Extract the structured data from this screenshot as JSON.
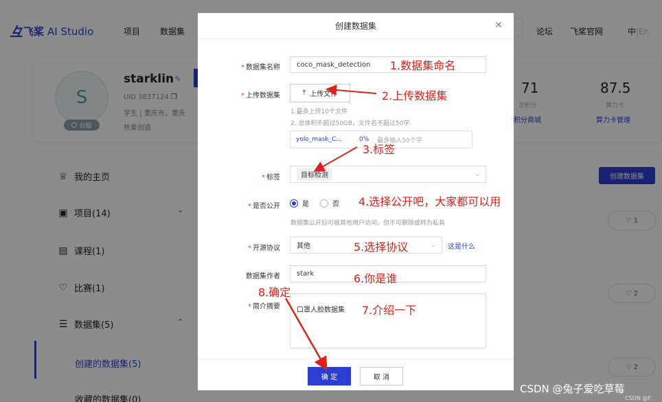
{
  "nav": {
    "logo_text": "飞桨",
    "logo_suffix": "AI Studio",
    "items": [
      "项目",
      "数据集"
    ],
    "right_items": [
      "论坛",
      "飞桨官网"
    ],
    "lang_active": "中",
    "lang_sep": "|",
    "lang_inactive": "En"
  },
  "profile": {
    "avatar_letter": "S",
    "badge": "白银",
    "name": "starklin",
    "uid": "UID 3837124",
    "school": "学生 | 重庆市，重庆",
    "hobby": "热爱创造",
    "stats": [
      {
        "value": "71",
        "label": "总积分",
        "link": "积分商城"
      },
      {
        "value": "87.5",
        "label": "算力卡",
        "link": "算力卡管理"
      }
    ]
  },
  "sidebar": {
    "items": [
      {
        "label": "我的主页",
        "icon": "trophy-icon"
      },
      {
        "label": "项目(14)",
        "icon": "project-icon"
      },
      {
        "label": "课程(1)",
        "icon": "course-icon"
      },
      {
        "label": "比赛(1)",
        "icon": "cup-icon"
      },
      {
        "label": "数据集(5)",
        "icon": "database-icon"
      }
    ],
    "sub_items": [
      "创建的数据集(5)",
      "收藏的数据集(0)"
    ]
  },
  "content": {
    "create_button": "创建数据集",
    "likes": [
      "1",
      "2",
      "2"
    ]
  },
  "modal": {
    "title": "创建数据集",
    "name_label": "数据集名称",
    "name_value": "coco_mask_detection",
    "upload_label": "上传数据集",
    "upload_button": "上传文件",
    "upload_hint1": "1.最多上传10个文件",
    "upload_hint2": "2. 总体积不超过50GB，文件名不超过50字",
    "file_name": "yolo_mask_C...",
    "file_progress": "0%",
    "file_placeholder": "最多输入50个字",
    "tag_label": "标签",
    "tag_value": "目标检测",
    "public_label": "是否公开",
    "public_yes": "是",
    "public_no": "否",
    "public_hint": "数据集公开后可被其他用户访问，但不可删除或转为私有",
    "license_label": "开源协议",
    "license_value": "其他",
    "license_link": "这是什么",
    "author_label": "数据集作者",
    "author_value": "stark",
    "desc_label": "简介摘要",
    "desc_value": "口罩人脸数据集",
    "ok": "确 定",
    "cancel": "取 消"
  },
  "annotations": {
    "a1": "1.数据集命名",
    "a2": "2.上传数据集",
    "a3": "3.标签",
    "a4": "4.选择公开吧，大家都可以用",
    "a5": "5.选择协议",
    "a6": "6.你是谁",
    "a7": "7.介绍一下",
    "a8": "8.确定"
  },
  "watermark": "CSDN @兔子爱吃草莓",
  "watermark_small": "CSDN @F",
  "colors": {
    "brand": "#2a3fd1",
    "annotation": "#e0201b"
  }
}
